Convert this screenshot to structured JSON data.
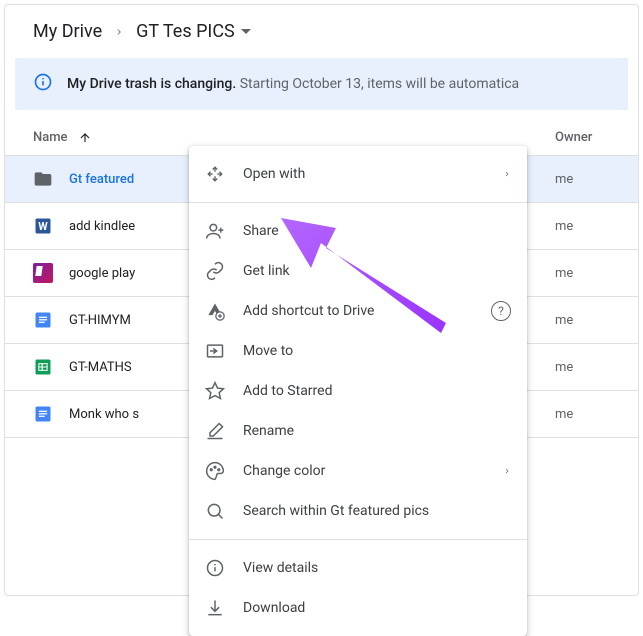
{
  "breadcrumb": {
    "root": "My Drive",
    "current": "GT Tes PICS"
  },
  "banner": {
    "bold": "My Drive trash is changing.",
    "rest": "Starting October 13, items will be automatica"
  },
  "columns": {
    "name": "Name",
    "owner": "Owner"
  },
  "rows": [
    {
      "icon": "folder",
      "name": "Gt featured",
      "owner": "me",
      "selected": true
    },
    {
      "icon": "word",
      "name": "add kindlee",
      "owner": "me"
    },
    {
      "icon": "thumb",
      "name": "google play",
      "owner": "me"
    },
    {
      "icon": "gdoc",
      "name": "GT-HIMYM",
      "owner": "me"
    },
    {
      "icon": "gsheet",
      "name": "GT-MATHS",
      "owner": "me"
    },
    {
      "icon": "gdoc",
      "name": "Monk who s",
      "owner": "me"
    }
  ],
  "menu": {
    "open_with": "Open with",
    "share": "Share",
    "get_link": "Get link",
    "add_shortcut": "Add shortcut to Drive",
    "move_to": "Move to",
    "add_starred": "Add to Starred",
    "rename": "Rename",
    "change_color": "Change color",
    "search_within": "Search within Gt featured pics",
    "view_details": "View details",
    "download": "Download"
  }
}
